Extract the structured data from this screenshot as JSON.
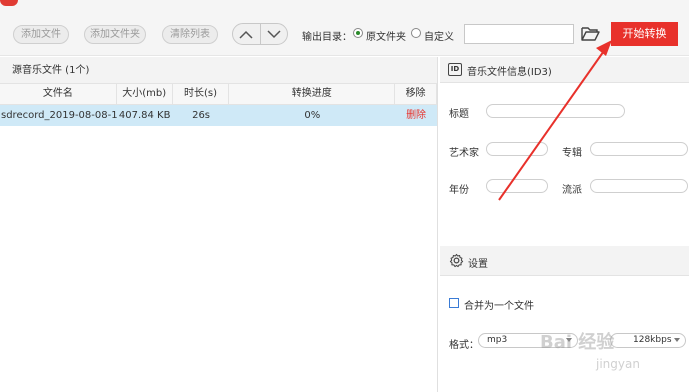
{
  "toolbar": {
    "add_file": "添加文件",
    "add_folder": "添加文件夹",
    "clear_list": "清除列表",
    "output_dir_label": "输出目录：",
    "radio_original": "原文件夹",
    "radio_custom": "自定义",
    "output_path_value": "",
    "start_button": "开始转换",
    "up_icon": "chevron-up-icon",
    "down_icon": "chevron-down-icon",
    "folder_icon": "folder-open-icon"
  },
  "file_list": {
    "title": "源音乐文件 (1个)",
    "columns": [
      "文件名",
      "大小(mb)",
      "时长(s)",
      "转换进度",
      "移除"
    ],
    "rows": [
      {
        "name": "sdrecord_2019-08-08-1...",
        "size": "407.84 KB",
        "duration": "26s",
        "progress": "0%",
        "remove": "删除"
      }
    ]
  },
  "id3": {
    "badge": "ID",
    "title": "音乐文件信息(ID3)",
    "title_label": "标题",
    "artist_label": "艺术家",
    "album_label": "专辑",
    "year_label": "年份",
    "genre_label": "流派"
  },
  "settings": {
    "title": "设置",
    "merge_label": "合并为一个文件",
    "format_label": "格式：",
    "format_value": "mp3",
    "bitrate_value": "128kbps"
  },
  "watermark": {
    "logo": "Bai 经验",
    "sub": "jingyan"
  },
  "colors": {
    "accent": "#e8312b",
    "selected_row": "#cfe9f7",
    "annotation_arrow": "#e8312b"
  }
}
